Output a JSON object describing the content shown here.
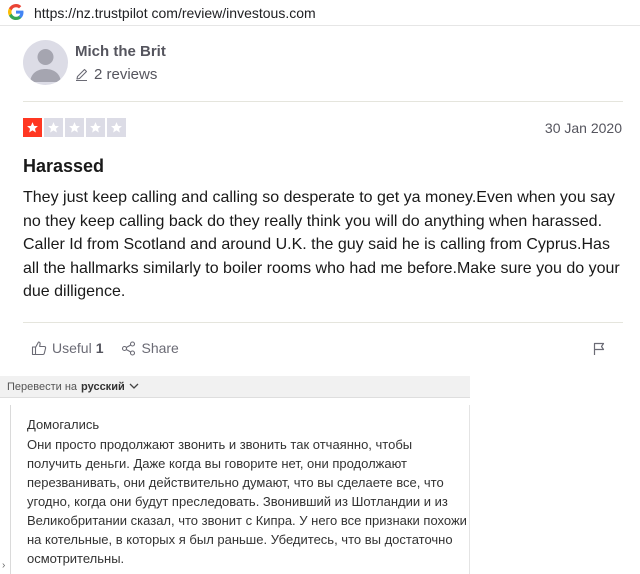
{
  "browser": {
    "url": "https://nz.trustpilot com/review/investous.com"
  },
  "reviewer": {
    "name": "Mich the Brit",
    "reviews_count": "2 reviews"
  },
  "review": {
    "rating": 1,
    "rating_max": 5,
    "date": "30 Jan 2020",
    "title": "Harassed",
    "body": "They just keep calling and calling so desperate to get ya money.Even when you say no they keep calling back do they really think you will do anything when harassed. Caller Id from Scotland and around U.K. the guy said he is calling from Cyprus.Has all the hallmarks similarly to boiler rooms who had me before.Make sure you do your due dilligence."
  },
  "actions": {
    "useful_label": "Useful",
    "useful_count": "1",
    "share_label": "Share"
  },
  "translate": {
    "prompt": "Перевести на",
    "language": "русский",
    "title": "Домогались",
    "body": "Они просто продолжают звонить и звонить так отчаянно, чтобы получить деньги. Даже когда вы говорите нет, они продолжают перезванивать, они действительно думают, что вы сделаете все, что угодно, когда они будут преследовать. Звонивший из Шотландии и из Великобритании сказал, что звонит с Кипра. У него все признаки похожи на котельные, в которых я был раньше. Убедитесь, что вы достаточно осмотрительны."
  },
  "colors": {
    "star_on": "#ff3722",
    "star_off": "#dcdce6"
  }
}
